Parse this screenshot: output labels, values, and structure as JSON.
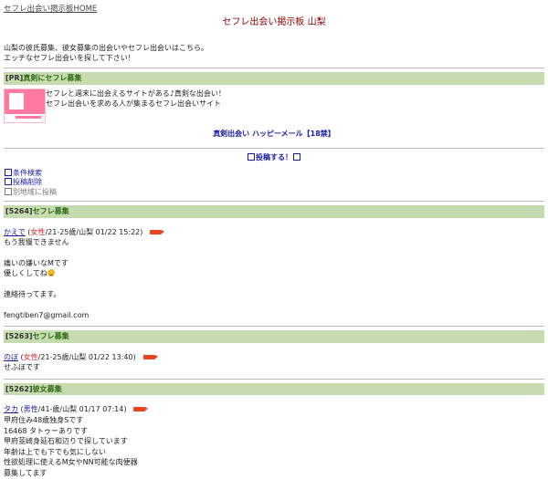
{
  "nav": {
    "home": "セフレ出会い掲示板HOME"
  },
  "header": {
    "title": "セフレ出会い掲示板 山梨"
  },
  "intro": {
    "line1": "山梨の彼氏募集、彼女募集の出会いやセフレ出会いはこちら。",
    "line2": "エッチなセフレ出会いを探して下さい！"
  },
  "pr": {
    "bar_prefix": "[PR]",
    "bar_title": "真剣にセフレ募集",
    "line1": "セフレと週末に出会えるサイトがある♪真剣な出会い！",
    "line2": "セフレ出会いを求める人が集まるセフレ出会いサイト",
    "link": "真剣出会い ハッピーメール【18禁】"
  },
  "post_button": {
    "label": "投稿する！"
  },
  "menu": {
    "search": "条件検索",
    "delete": "投稿削除",
    "other_region": "別地域に投稿"
  },
  "posts": [
    {
      "id": "[5264]",
      "category": "セフレ募集",
      "name": "かえで",
      "gender": "女性",
      "detail": "/21-25歳/山梨 01/22 15:22)",
      "gender_class": "female",
      "lines": [
        "もう我慢できません",
        "",
        "痛いの嫌いなMです",
        "優しくしてね",
        "",
        "連絡待ってます。",
        "",
        "fengtiben7@gmail.com"
      ],
      "smile_on_line": 3
    },
    {
      "id": "[5263]",
      "category": "セフレ募集",
      "name": "のぼ",
      "gender": "女性",
      "detail": "/21-25歳/山梨 01/22 13:40)",
      "gender_class": "female",
      "lines": [
        "せふぼです"
      ]
    },
    {
      "id": "[5262]",
      "category": "彼女募集",
      "name": "タカ",
      "gender": "男性",
      "detail": "/41-歳/山梨 01/17 07:14)",
      "gender_class": "male",
      "lines": [
        "甲府住み48歳独身Sです",
        "16468 タトゥーありです",
        "甲府韮崎身延石和辺りで探しています",
        "年齢は上でも下でも気にしない",
        "性欲処理に使えるM女やNN可能な肉便器",
        "募集してます"
      ]
    }
  ],
  "colors": {
    "bar_bg": "#c6dcb0",
    "title_red": "#8b0000",
    "link_blue": "#1a1aa6"
  }
}
